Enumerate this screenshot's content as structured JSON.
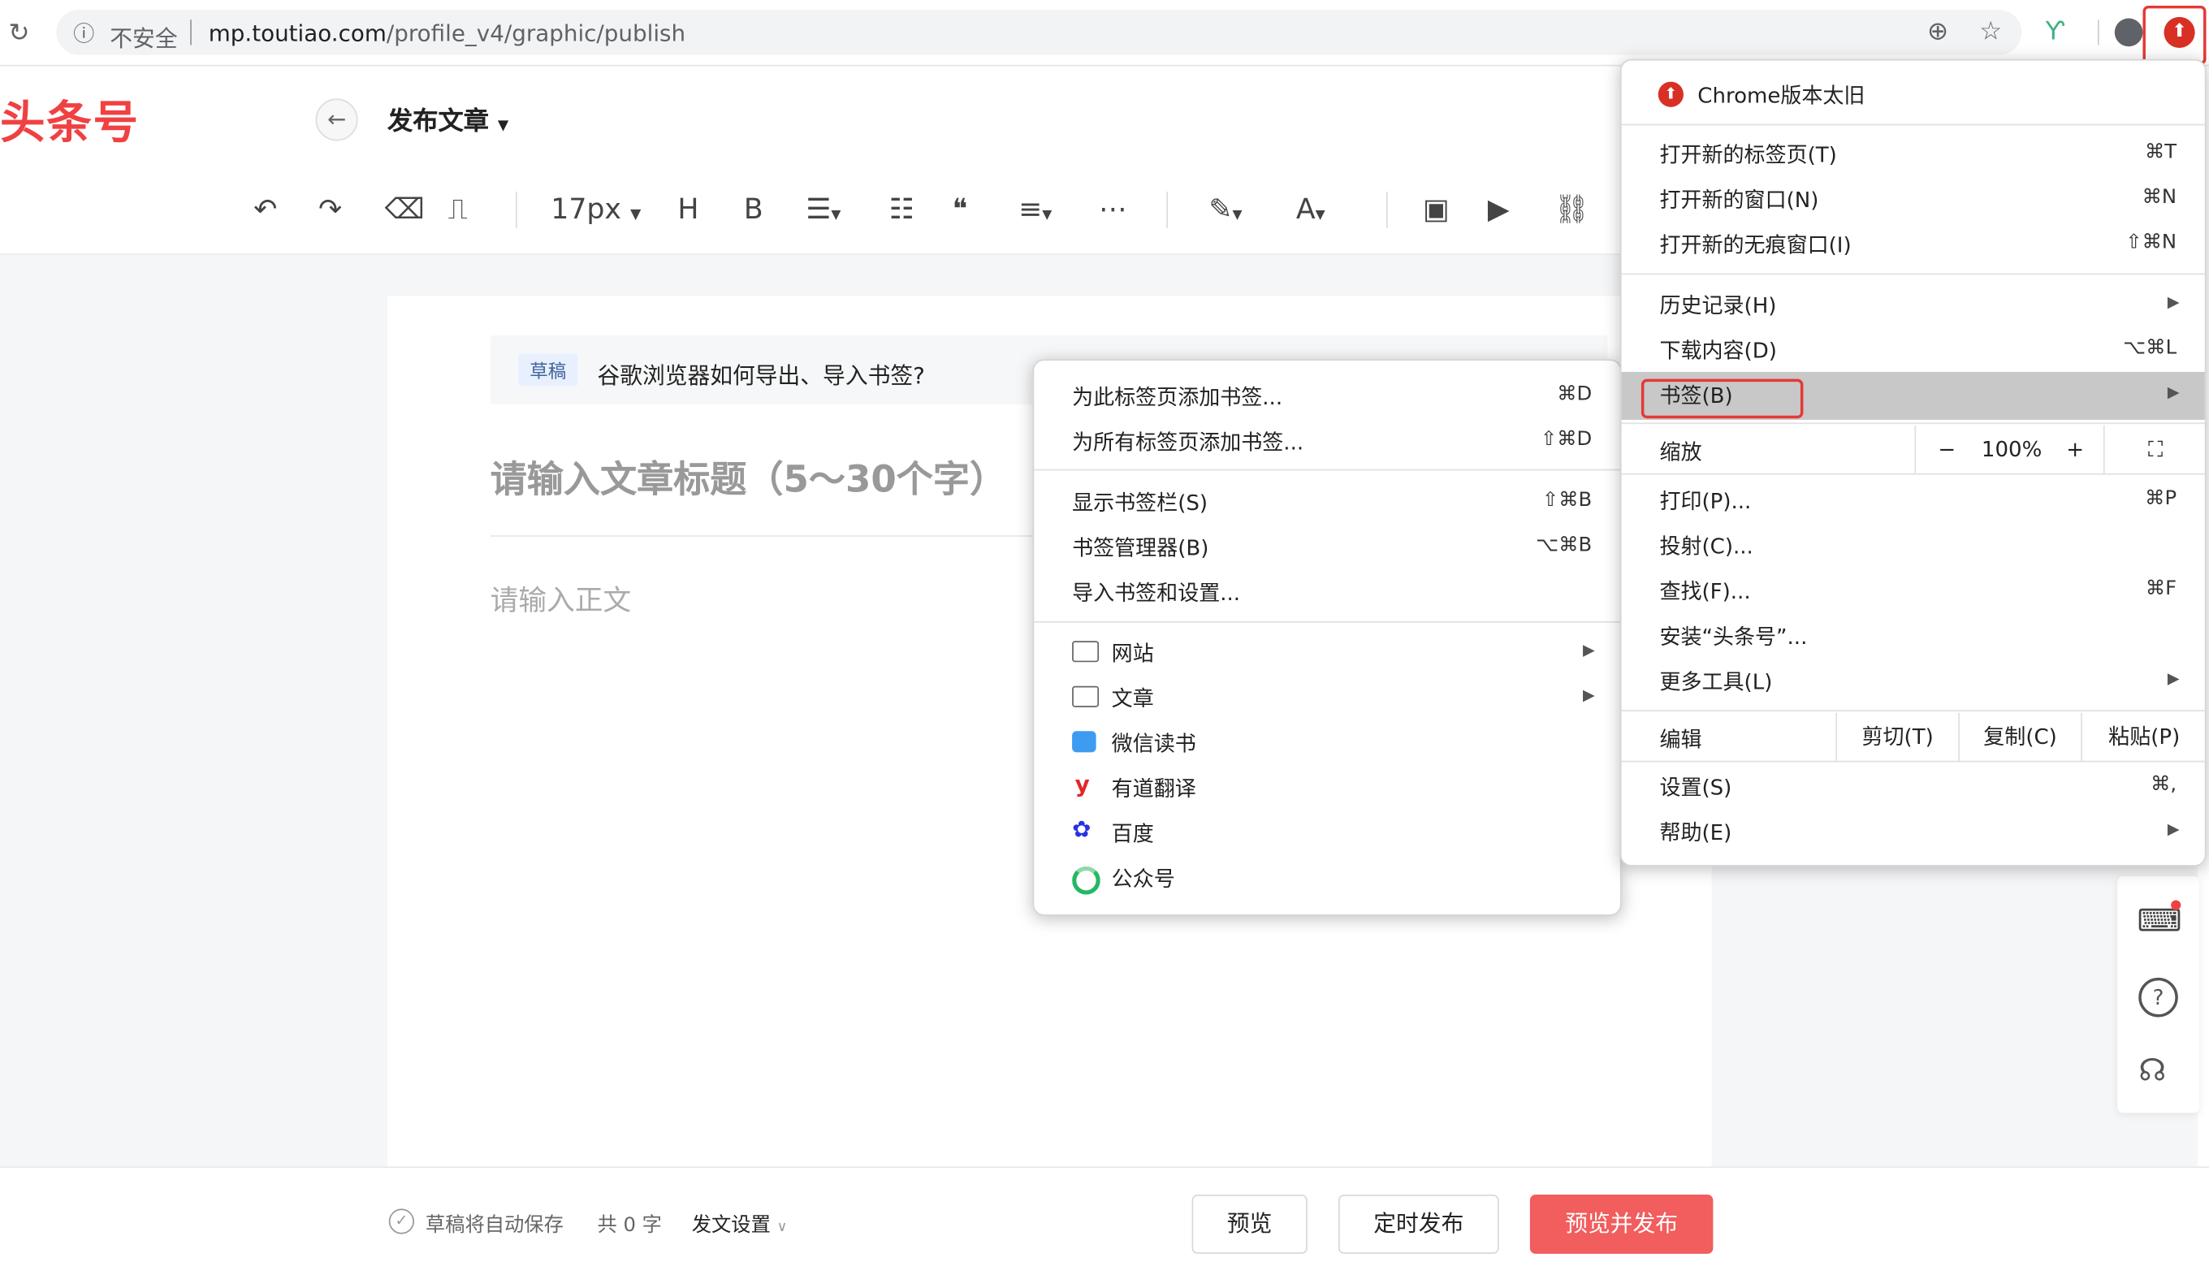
{
  "browser": {
    "insecure_label": "不安全",
    "url_host": "mp.toutiao.com",
    "url_path": "/profile_v4/graphic/publish"
  },
  "app": {
    "logo": "头条号",
    "page_title": "发布文章"
  },
  "toolbar": {
    "font_size": "17px",
    "heading": "H",
    "bold": "B"
  },
  "editor": {
    "draft_tag": "草稿",
    "draft_title": "谷歌浏览器如何导出、导入书签?",
    "title_placeholder": "请输入文章标题（5～30个字）",
    "body_placeholder": "请输入正文"
  },
  "footer": {
    "autosave": "草稿将自动保存",
    "word_count": "共 0 字",
    "publish_settings": "发文设置",
    "preview": "预览",
    "scheduled": "定时发布",
    "preview_publish": "预览并发布"
  },
  "chrome_menu": {
    "update": "Chrome版本太旧",
    "items_group1": [
      {
        "label": "打开新的标签页(T)",
        "shortcut": "⌘T"
      },
      {
        "label": "打开新的窗口(N)",
        "shortcut": "⌘N"
      },
      {
        "label": "打开新的无痕窗口(I)",
        "shortcut": "⇧⌘N"
      }
    ],
    "items_group2": [
      {
        "label": "历史记录(H)",
        "shortcut": "▶"
      },
      {
        "label": "下载内容(D)",
        "shortcut": "⌥⌘L"
      },
      {
        "label": "书签(B)",
        "shortcut": "▶"
      }
    ],
    "zoom_label": "缩放",
    "zoom_minus": "−",
    "zoom_value": "100%",
    "zoom_plus": "+",
    "items_group3": [
      {
        "label": "打印(P)...",
        "shortcut": "⌘P"
      },
      {
        "label": "投射(C)...",
        "shortcut": ""
      },
      {
        "label": "查找(F)...",
        "shortcut": "⌘F"
      },
      {
        "label": "安装“头条号”...",
        "shortcut": ""
      },
      {
        "label": "更多工具(L)",
        "shortcut": "▶"
      }
    ],
    "edit_label": "编辑",
    "cut": "剪切(T)",
    "copy": "复制(C)",
    "paste": "粘贴(P)",
    "items_group4": [
      {
        "label": "设置(S)",
        "shortcut": "⌘,"
      },
      {
        "label": "帮助(E)",
        "shortcut": "▶"
      }
    ]
  },
  "bookmarks_menu": {
    "items_group1": [
      {
        "label": "为此标签页添加书签...",
        "shortcut": "⌘D"
      },
      {
        "label": "为所有标签页添加书签...",
        "shortcut": "⇧⌘D"
      }
    ],
    "items_group2": [
      {
        "label": "显示书签栏(S)",
        "shortcut": "⇧⌘B"
      },
      {
        "label": "书签管理器(B)",
        "shortcut": "⌥⌘B"
      },
      {
        "label": "导入书签和设置...",
        "shortcut": ""
      }
    ],
    "folders": [
      {
        "label": "网站"
      },
      {
        "label": "文章"
      }
    ],
    "bookmarks": [
      {
        "label": "微信读书",
        "icon": "weread-icon",
        "color": "#3d9bf0"
      },
      {
        "label": "有道翻译",
        "icon": "youdao-icon",
        "color": "#e0282a"
      },
      {
        "label": "百度",
        "icon": "baidu-icon",
        "color": "#2932e1"
      },
      {
        "label": "公众号",
        "icon": "wechat-mp-icon",
        "color": "#25b864"
      }
    ]
  },
  "colors": {
    "brand": "#f04142",
    "highlight_box": "#e53935",
    "menu_hover": "#c8c8c8"
  }
}
